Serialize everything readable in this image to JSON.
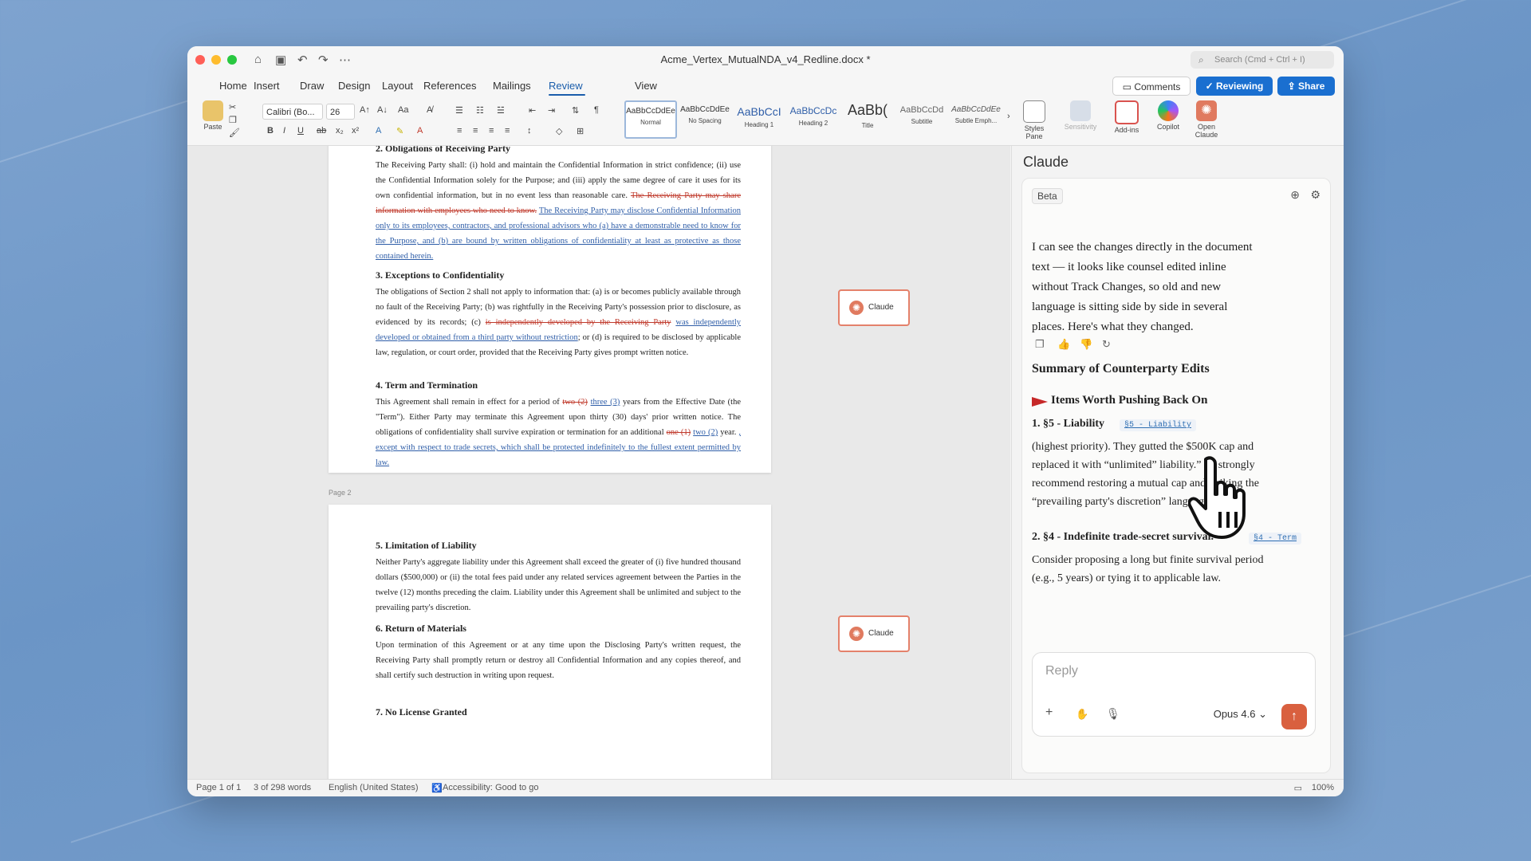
{
  "window": {
    "title": "Acme_Vertex_MutualNDA_v4_Redline.docx *",
    "search_placeholder": "Search (Cmd + Ctrl + I)"
  },
  "menu": {
    "tabs": [
      "Home",
      "Insert",
      "Draw",
      "Design",
      "Layout",
      "References",
      "Mailings",
      "Review",
      "View"
    ],
    "active": "Review",
    "comments_label": "Comments",
    "reviewing_label": "Reviewing",
    "share_label": "Share"
  },
  "ribbon": {
    "paste_label": "Paste",
    "font_name": "Calibri (Bo...",
    "font_size": "26",
    "case_label": "Aa",
    "styles": [
      {
        "sample": "AaBbCcDdEe",
        "label": "Normal"
      },
      {
        "sample": "AaBbCcDdEe",
        "label": "No Spacing"
      },
      {
        "sample": "AaBbCcI",
        "label": "Heading 1"
      },
      {
        "sample": "AaBbCcDc",
        "label": "Heading 2"
      },
      {
        "sample": "AaBb(",
        "label": "Title"
      },
      {
        "sample": "AaBbCcDd",
        "label": "Subtitle"
      },
      {
        "sample": "AaBbCcDdEe",
        "label": "Subtle Emph..."
      }
    ],
    "styles_pane_label": "Styles Pane",
    "sensitivity_label": "Sensitivity",
    "addins_label": "Add-ins",
    "copilot_label": "Copilot",
    "open_claude_label": "Open Claude"
  },
  "document": {
    "s2_heading": "2. Obligations of Receiving Party",
    "s2_text": "The Receiving Party shall: (i) hold and maintain the Confidential Information in strict confidence; (ii) use the Confidential Information solely for the Purpose; and (iii) apply the same degree of care it uses for its own confidential information, but in no event less than reasonable care.",
    "s2_del": "The Receiving Party may share information with employees who need to know.",
    "s2_ins": "The Receiving Party may disclose Confidential Information only to its employees, contractors, and professional advisors who (a) have a demonstrable need to know for the Purpose, and (b) are bound by written obligations of confidentiality at least as protective as those contained herein.",
    "s3_heading": "3. Exceptions to Confidentiality",
    "s3_text_a": "The obligations of Section 2 shall not apply to information that: (a) is or becomes publicly available through no fault of the Receiving Party; (b) was rightfully in the Receiving Party's possession prior to disclosure, as evidenced by its records; (c)",
    "s3_del": "is independently developed by the Receiving Party",
    "s3_ins": "was independently developed or obtained from a third party without restriction",
    "s3_text_b": "; or (d) is required to be disclosed by applicable law, regulation, or court order, provided that the Receiving Party gives prompt written notice.",
    "s4_heading": "4. Term and Termination",
    "s4_a": "This Agreement shall remain in effect for a period of",
    "s4_del1": "two (2)",
    "s4_ins1": "three (3)",
    "s4_b": "years from the Effective Date (the \"Term\"). Either Party may terminate this Agreement upon thirty (30) days' prior written notice. The obligations of confidentiality shall survive expiration or termination for an additional",
    "s4_del2": "one (1)",
    "s4_ins2": "two (2)",
    "s4_c": "year.",
    "s4_ins3": ", except with respect to trade secrets, which shall be protected indefinitely to the fullest extent permitted by law.",
    "page2_label": "Page 2",
    "s5_heading": "5. Limitation of Liability",
    "s5_text": "Neither Party's aggregate liability under this Agreement shall exceed the greater of (i) five hundred thousand dollars ($500,000) or (ii) the total fees paid under any related services agreement between the Parties in the twelve (12) months preceding the claim. Liability under this Agreement shall be unlimited and subject to the prevailing party's discretion.",
    "s6_heading": "6. Return of Materials",
    "s6_text": "Upon termination of this Agreement or at any time upon the Disclosing Party's written request, the Receiving Party shall promptly return or destroy all Confidential Information and any copies thereof, and shall certify such destruction in writing upon request.",
    "s7_heading": "7. No License Granted",
    "claude_chip": "Claude"
  },
  "pane": {
    "title": "Claude",
    "beta": "Beta",
    "message": "I can see the changes directly in the document text — it looks like counsel edited inline without Track Changes, so old and new language is sitting side by side in several places. Here's what they changed.",
    "summary_heading": "Summary of Counterparty Edits",
    "items_heading": "Items Worth Pushing Back On",
    "item1_title": "1. §5 - Liability",
    "item1_chip": "§5 - Liability",
    "item1_body": "(highest priority). They gutted the $500K cap and replaced it with “unlimited” liability.” I'd strongly recommend restoring a mutual cap and striking the “prevailing party's discretion” language.",
    "item2_title": "2. §4 - Indefinite trade-secret survival.",
    "item2_chip": "§4 - Term",
    "item2_body": "Consider proposing a long but finite survival period (e.g., 5 years) or tying it to applicable law.",
    "reply_placeholder": "Reply",
    "model": "Opus 4.6"
  },
  "status": {
    "page": "Page 1 of 1",
    "words": "3 of 298 words",
    "language": "English (United States)",
    "accessibility": "Accessibility: Good to go",
    "zoom": "100%"
  },
  "colors": {
    "accent": "#1a6fd0",
    "claude": "#e07a5f",
    "deletion": "#c0392b",
    "insertion": "#2f5ea8"
  }
}
